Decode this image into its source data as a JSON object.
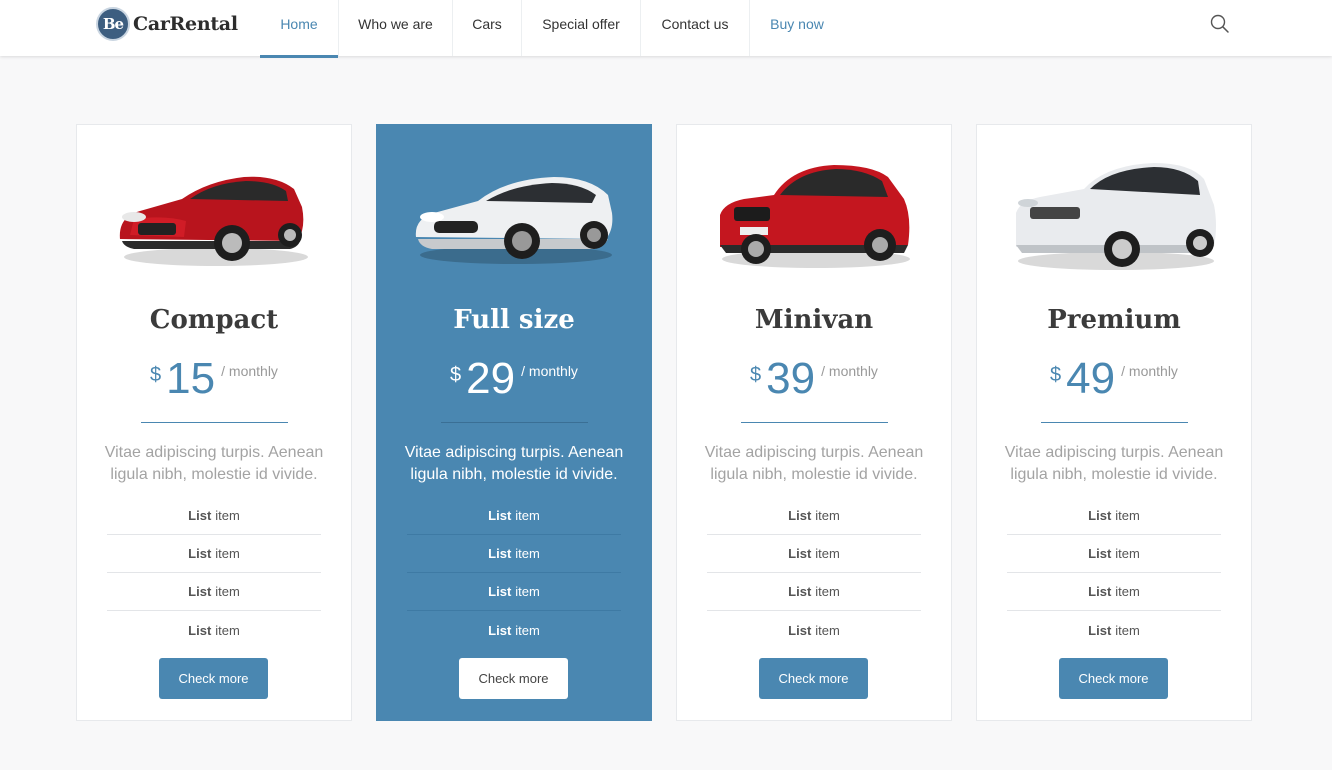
{
  "brand": {
    "badge": "Be",
    "name": "CarRental"
  },
  "nav": {
    "items": [
      {
        "label": "Home"
      },
      {
        "label": "Who we are"
      },
      {
        "label": "Cars"
      },
      {
        "label": "Special offer"
      },
      {
        "label": "Contact us"
      },
      {
        "label": "Buy now"
      }
    ],
    "active": "Home",
    "search_icon": "search-icon"
  },
  "colors": {
    "accent": "#4a87b1",
    "background": "#f8f8f9",
    "card": "#ffffff"
  },
  "plans": [
    {
      "name": "Compact",
      "currency": "$",
      "price": "15",
      "period": "/ monthly",
      "description": "Vitae adipiscing turpis. Aenean ligula nibh, molestie id vivide.",
      "items": [
        {
          "bold": "List",
          "text": "item"
        },
        {
          "bold": "List",
          "text": "item"
        },
        {
          "bold": "List",
          "text": "item"
        },
        {
          "bold": "List",
          "text": "item"
        }
      ],
      "button": "Check more",
      "image": "red-hatchback-car",
      "featured": false
    },
    {
      "name": "Full size",
      "currency": "$",
      "price": "29",
      "period": "/ monthly",
      "description": "Vitae adipiscing turpis. Aenean ligula nibh, molestie id vivide.",
      "items": [
        {
          "bold": "List",
          "text": "item"
        },
        {
          "bold": "List",
          "text": "item"
        },
        {
          "bold": "List",
          "text": "item"
        },
        {
          "bold": "List",
          "text": "item"
        }
      ],
      "button": "Check more",
      "image": "white-sports-car",
      "featured": true
    },
    {
      "name": "Minivan",
      "currency": "$",
      "price": "39",
      "period": "/ monthly",
      "description": "Vitae adipiscing turpis. Aenean ligula nibh, molestie id vivide.",
      "items": [
        {
          "bold": "List",
          "text": "item"
        },
        {
          "bold": "List",
          "text": "item"
        },
        {
          "bold": "List",
          "text": "item"
        },
        {
          "bold": "List",
          "text": "item"
        }
      ],
      "button": "Check more",
      "image": "red-suv-car",
      "featured": false
    },
    {
      "name": "Premium",
      "currency": "$",
      "price": "49",
      "period": "/ monthly",
      "description": "Vitae adipiscing turpis. Aenean ligula nibh, molestie id vivide.",
      "items": [
        {
          "bold": "List",
          "text": "item"
        },
        {
          "bold": "List",
          "text": "item"
        },
        {
          "bold": "List",
          "text": "item"
        },
        {
          "bold": "List",
          "text": "item"
        }
      ],
      "button": "Check more",
      "image": "white-luxury-suv",
      "featured": false
    }
  ]
}
